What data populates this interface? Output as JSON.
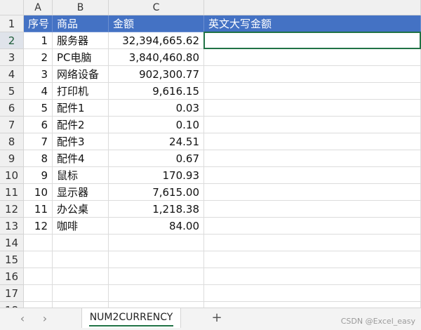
{
  "columns": [
    "A",
    "B",
    "C",
    ""
  ],
  "header_row": {
    "a": "序号",
    "b": "商品",
    "c": "金额",
    "d": "英文大写金额"
  },
  "rows": [
    {
      "a": "1",
      "b": "服务器",
      "c": "32,394,665.62",
      "d": ""
    },
    {
      "a": "2",
      "b": "PC电脑",
      "c": "3,840,460.80",
      "d": ""
    },
    {
      "a": "3",
      "b": "网络设备",
      "c": "902,300.77",
      "d": ""
    },
    {
      "a": "4",
      "b": "打印机",
      "c": "9,616.15",
      "d": ""
    },
    {
      "a": "5",
      "b": "配件1",
      "c": "0.03",
      "d": ""
    },
    {
      "a": "6",
      "b": "配件2",
      "c": "0.10",
      "d": ""
    },
    {
      "a": "7",
      "b": "配件3",
      "c": "24.51",
      "d": ""
    },
    {
      "a": "8",
      "b": "配件4",
      "c": "0.67",
      "d": ""
    },
    {
      "a": "9",
      "b": "鼠标",
      "c": "170.93",
      "d": ""
    },
    {
      "a": "10",
      "b": "显示器",
      "c": "7,615.00",
      "d": ""
    },
    {
      "a": "11",
      "b": "办公桌",
      "c": "1,218.38",
      "d": ""
    },
    {
      "a": "12",
      "b": "咖啡",
      "c": "84.00",
      "d": ""
    }
  ],
  "row_numbers": [
    "1",
    "2",
    "3",
    "4",
    "5",
    "6",
    "7",
    "8",
    "9",
    "10",
    "11",
    "12",
    "13",
    "14",
    "15",
    "16",
    "17",
    "18"
  ],
  "active_row": "2",
  "sheet_tab": "NUM2CURRENCY",
  "nav": {
    "prev_icon": "‹",
    "next_icon": "›",
    "add_icon": "+"
  },
  "watermark": "CSDN @Excel_easy",
  "colors": {
    "header_fill": "#4472c4",
    "selection": "#217346"
  }
}
